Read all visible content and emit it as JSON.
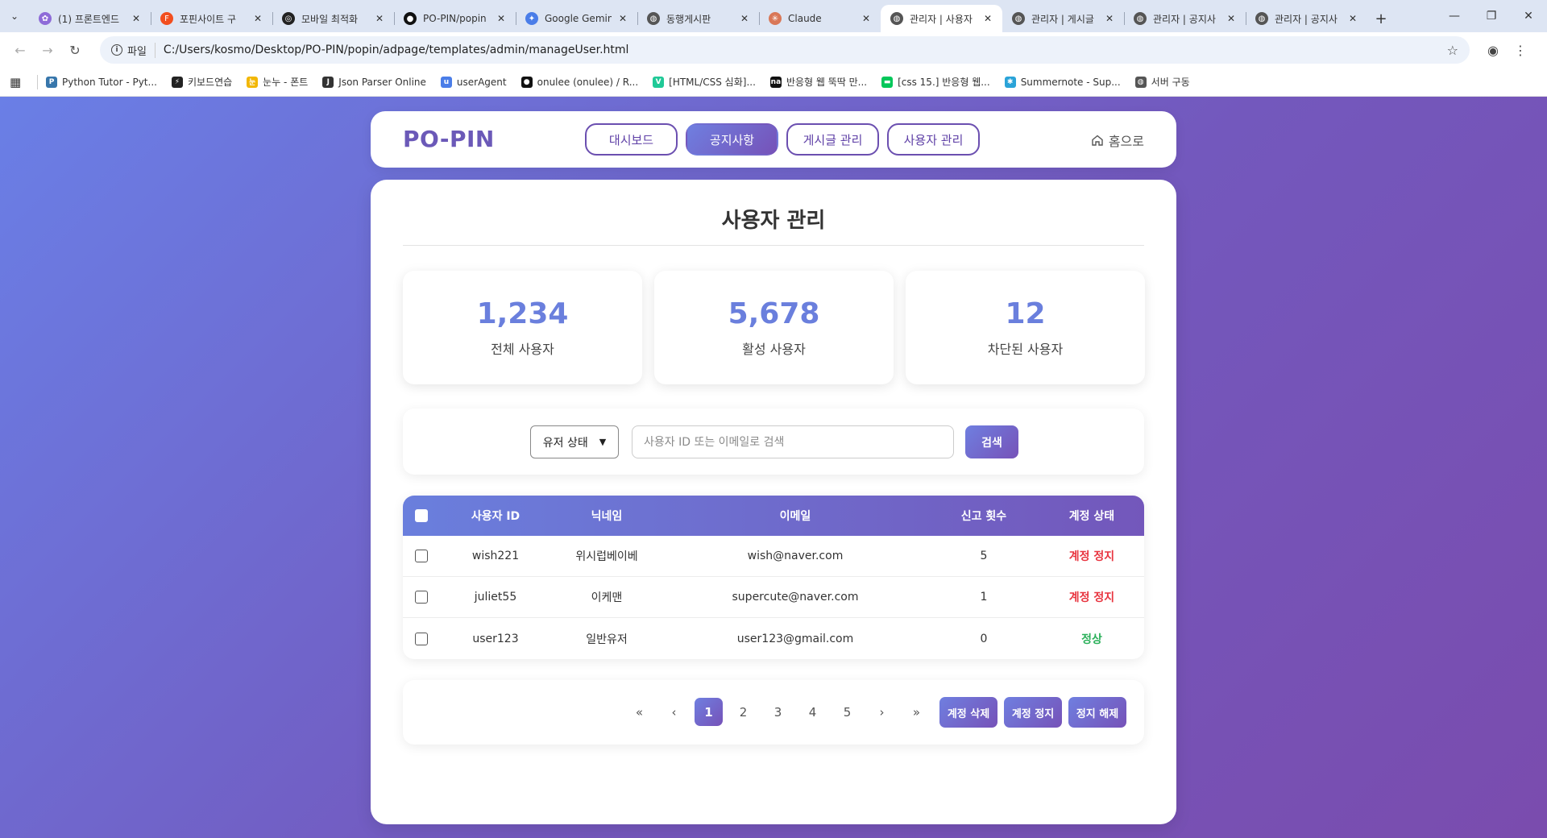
{
  "browser": {
    "tabs": [
      {
        "title": "(1) 프론트엔드",
        "fav_color": "#8e6bd8",
        "fav_glyph": "✿",
        "active": false
      },
      {
        "title": "포핀사이트 구",
        "fav_color": "#f24e1e",
        "fav_glyph": "F",
        "active": false
      },
      {
        "title": "모바일 최적화",
        "fav_color": "#222222",
        "fav_glyph": "◎",
        "active": false
      },
      {
        "title": "PO-PIN/popin",
        "fav_color": "#111111",
        "fav_glyph": "●",
        "active": false
      },
      {
        "title": "Google Gemin",
        "fav_color": "#4a7de8",
        "fav_glyph": "✦",
        "active": false
      },
      {
        "title": "동행게시판",
        "fav_color": "#555555",
        "fav_glyph": "◍",
        "active": false
      },
      {
        "title": "Claude",
        "fav_color": "#d97757",
        "fav_glyph": "✳",
        "active": false
      },
      {
        "title": "관리자 | 사용자",
        "fav_color": "#555555",
        "fav_glyph": "◍",
        "active": true
      },
      {
        "title": "관리자 | 게시글",
        "fav_color": "#555555",
        "fav_glyph": "◍",
        "active": false
      },
      {
        "title": "관리자 | 공지사",
        "fav_color": "#555555",
        "fav_glyph": "◍",
        "active": false
      },
      {
        "title": "관리자 | 공지사",
        "fav_color": "#555555",
        "fav_glyph": "◍",
        "active": false
      }
    ],
    "scheme_label": "파일",
    "url": "C:/Users/kosmo/Desktop/PO-PIN/popin/adpage/templates/admin/manageUser.html",
    "bookmarks": [
      {
        "label": "Python Tutor - Pyt...",
        "color": "#3776ab",
        "glyph": "P"
      },
      {
        "label": "키보드연습",
        "color": "#222222",
        "glyph": "⚡"
      },
      {
        "label": "눈누 - 폰트",
        "color": "#f2b705",
        "glyph": "눈"
      },
      {
        "label": "Json Parser Online",
        "color": "#333333",
        "glyph": "J"
      },
      {
        "label": "userAgent",
        "color": "#4a7de8",
        "glyph": "u"
      },
      {
        "label": "onulee (onulee) / R...",
        "color": "#111111",
        "glyph": "●"
      },
      {
        "label": "[HTML/CSS 심화]...",
        "color": "#20c997",
        "glyph": "V"
      },
      {
        "label": "반응형 웹 뚝딱 만...",
        "color": "#111111",
        "glyph": "na"
      },
      {
        "label": "[css 15.] 반응형 웹...",
        "color": "#03c75a",
        "glyph": "▬"
      },
      {
        "label": "Summernote - Sup...",
        "color": "#2aa3d8",
        "glyph": "✱"
      },
      {
        "label": "서버 구동",
        "color": "#555555",
        "glyph": "◍"
      }
    ]
  },
  "header": {
    "logo": "PO-PIN",
    "nav": [
      {
        "label": "대시보드",
        "active": false
      },
      {
        "label": "공지사항",
        "active": true
      },
      {
        "label": "게시글 관리",
        "active": false
      },
      {
        "label": "사용자 관리",
        "active": false
      }
    ],
    "home_label": "홈으로"
  },
  "main": {
    "title": "사용자 관리",
    "stats": [
      {
        "value": "1,234",
        "label": "전체 사용자"
      },
      {
        "value": "5,678",
        "label": "활성 사용자"
      },
      {
        "value": "12",
        "label": "차단된 사용자"
      }
    ],
    "search": {
      "status_select": "유저 상태",
      "placeholder": "사용자 ID 또는 이메일로 검색",
      "value": "",
      "button": "검색"
    },
    "table": {
      "headers": {
        "id": "사용자 ID",
        "nickname": "닉네임",
        "email": "이메일",
        "reports": "신고 횟수",
        "status": "계정 상태"
      },
      "rows": [
        {
          "id": "wish221",
          "nickname": "위시럽베이베",
          "email": "wish@naver.com",
          "reports": "5",
          "status": "계정 정지",
          "status_color": "#e8343f"
        },
        {
          "id": "juliet55",
          "nickname": "이케맨",
          "email": "supercute@naver.com",
          "reports": "1",
          "status": "계정 정지",
          "status_color": "#e8343f"
        },
        {
          "id": "user123",
          "nickname": "일반유저",
          "email": "user123@gmail.com",
          "reports": "0",
          "status": "정상",
          "status_color": "#2bb05a"
        }
      ]
    },
    "pagination": {
      "first": "«",
      "prev": "‹",
      "next": "›",
      "last": "»",
      "pages": [
        "1",
        "2",
        "3",
        "4",
        "5"
      ],
      "current": "1"
    },
    "actions": {
      "delete": "계정 삭제",
      "suspend": "계정 정지",
      "unsuspend": "정지 해제"
    }
  },
  "colors": {
    "accent_start": "#6a7fdd",
    "accent_end": "#7652b8",
    "danger": "#e8343f",
    "ok": "#2bb05a"
  }
}
